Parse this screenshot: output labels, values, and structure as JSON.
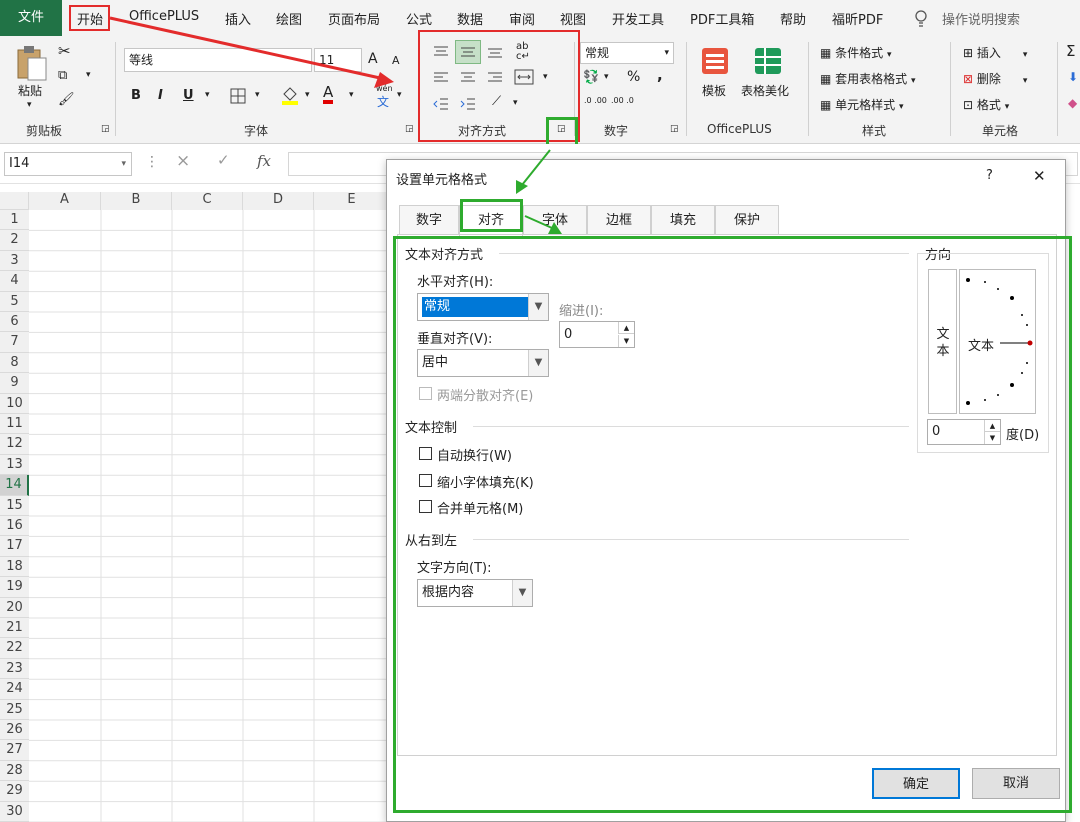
{
  "menu": {
    "file": "文件",
    "items": [
      "开始",
      "OfficePLUS",
      "插入",
      "绘图",
      "页面布局",
      "公式",
      "数据",
      "审阅",
      "视图",
      "开发工具",
      "PDF工具箱",
      "帮助",
      "福昕PDF"
    ],
    "search": "操作说明搜索"
  },
  "ribbon": {
    "clipboard": {
      "paste": "粘贴",
      "label": "剪贴板"
    },
    "font": {
      "name": "等线",
      "size": "11",
      "label": "字体",
      "bold": "B",
      "italic": "I",
      "underline": "U",
      "grow": "A",
      "shrink": "A",
      "color_letter": "A",
      "wen": "wén",
      "wen2": "文"
    },
    "alignment": {
      "label": "对齐方式",
      "wrap": "ab"
    },
    "number": {
      "format": "常规",
      "percent": "%",
      "comma": ",",
      "label": "数字",
      "dec_up": ".0 .00",
      "dec_down": ".00 .0"
    },
    "officeplus": {
      "template": "模板",
      "beautify": "表格美化",
      "label": "OfficePLUS"
    },
    "styles": {
      "conditional": "条件格式",
      "table_format": "套用表格格式",
      "cell_style": "单元格样式",
      "label": "样式"
    },
    "cells": {
      "insert": "插入",
      "delete": "删除",
      "format": "格式",
      "label": "单元格"
    },
    "sigma": "Σ"
  },
  "formula_bar": {
    "name_box": "I14",
    "fx": "fx",
    "cancel": "×",
    "confirm": "✓",
    "dots": "⋮"
  },
  "sheet": {
    "columns": [
      "A",
      "B",
      "C",
      "D",
      "E"
    ],
    "rows": [
      "1",
      "2",
      "3",
      "4",
      "5",
      "6",
      "7",
      "8",
      "9",
      "10",
      "11",
      "12",
      "13",
      "14",
      "15",
      "16",
      "17",
      "18",
      "19",
      "20",
      "21",
      "22",
      "23",
      "24",
      "25",
      "26",
      "27",
      "28",
      "29",
      "30"
    ],
    "active_row": "14"
  },
  "dialog": {
    "title": "设置单元格格式",
    "help": "?",
    "close": "✕",
    "tabs": [
      "数字",
      "对齐",
      "字体",
      "边框",
      "填充",
      "保护"
    ],
    "active_tab": "对齐",
    "text_alignment": {
      "title": "文本对齐方式",
      "horizontal_label": "水平对齐(H):",
      "horizontal_value": "常规",
      "indent_label": "缩进(I):",
      "indent_value": "0",
      "vertical_label": "垂直对齐(V):",
      "vertical_value": "居中",
      "justify_distributed": "两端分散对齐(E)"
    },
    "text_control": {
      "title": "文本控制",
      "wrap": "自动换行(W)",
      "shrink": "缩小字体填充(K)",
      "merge": "合并单元格(M)"
    },
    "rtl": {
      "title": "从右到左",
      "direction_label": "文字方向(T):",
      "direction_value": "根据内容"
    },
    "orientation": {
      "title": "方向",
      "vertical_text": "文本",
      "horizontal_text": "文本",
      "degree_value": "0",
      "degree_label": "度(D)"
    },
    "ok": "确定",
    "cancel": "取消"
  },
  "colors": {
    "excel_green": "#217346",
    "highlight_red": "#e32b2b",
    "highlight_green": "#2eab2e",
    "selection_blue": "#0078d7"
  }
}
